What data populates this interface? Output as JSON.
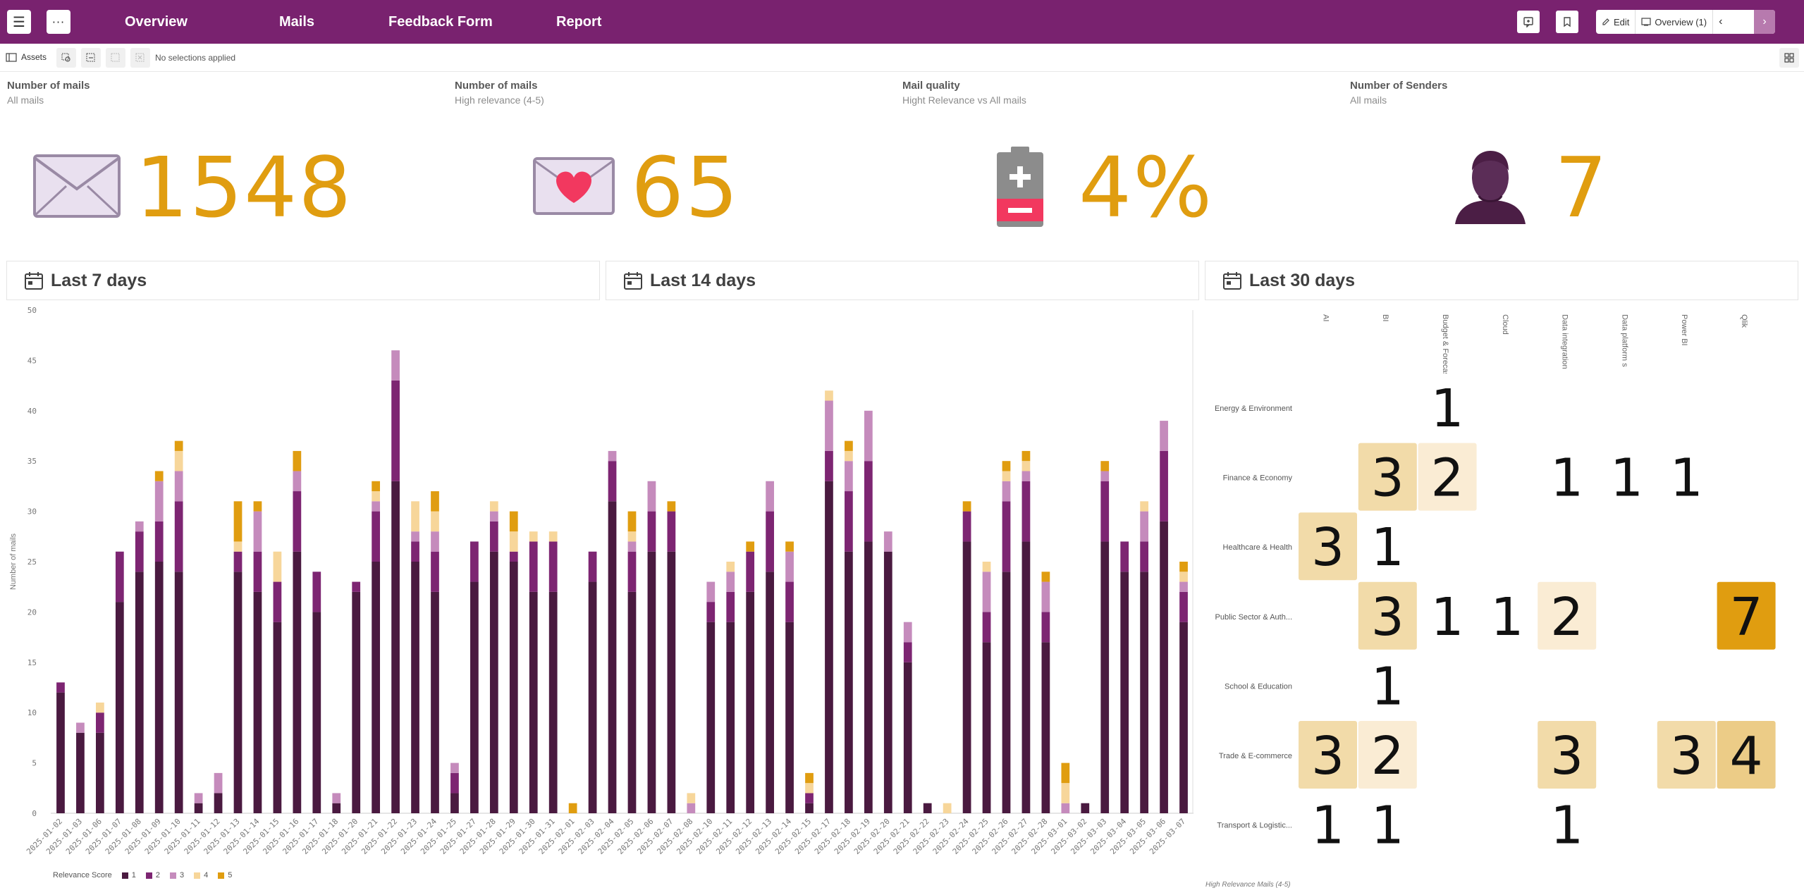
{
  "nav": {
    "tabs": [
      "Overview",
      "Mails",
      "Feedback Form",
      "Report"
    ],
    "edit_label": "Edit",
    "sheet_label": "Overview (1)"
  },
  "selection_bar": {
    "assets_label": "Assets",
    "status": "No selections applied"
  },
  "kpis": [
    {
      "title": "Number of mails",
      "subtitle": "All mails",
      "value": "1548",
      "icon": "envelope-icon"
    },
    {
      "title": "Number of mails",
      "subtitle": "High relevance (4-5)",
      "value": "65",
      "icon": "envelope-heart-icon"
    },
    {
      "title": "Mail quality",
      "subtitle": "Hight Relevance vs All mails",
      "value": "4%",
      "icon": "battery-icon"
    },
    {
      "title": "Number of Senders",
      "subtitle": "All mails",
      "value": "7",
      "icon": "person-icon"
    }
  ],
  "sections": [
    "Last 7 days",
    "Last 14 days",
    "Last 30 days"
  ],
  "colors": {
    "brand": "#79226f",
    "accent": "#e09d10",
    "score1": "#4a1a40",
    "score2": "#7d2572",
    "score3": "#c58bbc",
    "score4": "#f7d69a",
    "score5": "#e09d10"
  },
  "chart_data": [
    {
      "type": "bar",
      "stacked": true,
      "ylabel": "Number of mails",
      "ylim": [
        0,
        50
      ],
      "yticks": [
        0,
        5,
        10,
        15,
        20,
        25,
        30,
        35,
        40,
        45,
        50
      ],
      "legend_title": "Relevance Score",
      "legend_position": "bottom-left",
      "categories": [
        "2025-01-02",
        "2025-01-03",
        "2025-01-06",
        "2025-01-07",
        "2025-01-08",
        "2025-01-09",
        "2025-01-10",
        "2025-01-11",
        "2025-01-12",
        "2025-01-13",
        "2025-01-14",
        "2025-01-15",
        "2025-01-16",
        "2025-01-17",
        "2025-01-18",
        "2025-01-20",
        "2025-01-21",
        "2025-01-22",
        "2025-01-23",
        "2025-01-24",
        "2025-01-25",
        "2025-01-27",
        "2025-01-28",
        "2025-01-29",
        "2025-01-30",
        "2025-01-31",
        "2025-02-01",
        "2025-02-03",
        "2025-02-04",
        "2025-02-05",
        "2025-02-06",
        "2025-02-07",
        "2025-02-08",
        "2025-02-10",
        "2025-02-11",
        "2025-02-12",
        "2025-02-13",
        "2025-02-14",
        "2025-02-15",
        "2025-02-17",
        "2025-02-18",
        "2025-02-19",
        "2025-02-20",
        "2025-02-21",
        "2025-02-22",
        "2025-02-23",
        "2025-02-24",
        "2025-02-25",
        "2025-02-26",
        "2025-02-27",
        "2025-02-28",
        "2025-03-01",
        "2025-03-02",
        "2025-03-03",
        "2025-03-04",
        "2025-03-05",
        "2025-03-06",
        "2025-03-07"
      ],
      "series": [
        {
          "name": "1",
          "values": [
            12,
            8,
            8,
            21,
            24,
            25,
            24,
            1,
            2,
            24,
            22,
            19,
            26,
            20,
            1,
            22,
            25,
            33,
            25,
            22,
            2,
            23,
            26,
            25,
            22,
            22,
            0,
            23,
            31,
            22,
            26,
            26,
            0,
            19,
            19,
            22,
            24,
            19,
            1,
            33,
            26,
            27,
            26,
            15,
            1,
            0,
            27,
            17,
            24,
            27,
            17,
            0,
            1,
            27,
            24,
            24,
            29,
            19
          ]
        },
        {
          "name": "2",
          "values": [
            1,
            0,
            2,
            5,
            4,
            4,
            7,
            0,
            0,
            2,
            4,
            4,
            6,
            4,
            0,
            1,
            5,
            10,
            2,
            4,
            2,
            4,
            3,
            1,
            5,
            5,
            0,
            3,
            4,
            4,
            4,
            4,
            0,
            2,
            3,
            4,
            6,
            4,
            1,
            3,
            6,
            8,
            0,
            2,
            0,
            0,
            3,
            3,
            7,
            6,
            3,
            0,
            0,
            6,
            3,
            3,
            7,
            3
          ]
        },
        {
          "name": "3",
          "values": [
            0,
            1,
            0,
            0,
            1,
            4,
            3,
            1,
            2,
            0,
            4,
            0,
            2,
            0,
            1,
            0,
            1,
            3,
            1,
            2,
            1,
            0,
            1,
            0,
            0,
            0,
            0,
            0,
            1,
            1,
            3,
            0,
            1,
            2,
            2,
            0,
            3,
            3,
            0,
            5,
            3,
            5,
            2,
            2,
            0,
            0,
            0,
            4,
            2,
            1,
            3,
            1,
            0,
            1,
            0,
            3,
            3,
            1
          ]
        },
        {
          "name": "4",
          "values": [
            0,
            0,
            1,
            0,
            0,
            0,
            2,
            0,
            0,
            1,
            0,
            3,
            0,
            0,
            0,
            0,
            1,
            0,
            3,
            2,
            0,
            0,
            1,
            2,
            1,
            1,
            0,
            0,
            0,
            1,
            0,
            0,
            1,
            0,
            1,
            0,
            0,
            0,
            1,
            1,
            1,
            0,
            0,
            0,
            0,
            1,
            0,
            1,
            1,
            1,
            0,
            2,
            0,
            0,
            0,
            1,
            0,
            1
          ]
        },
        {
          "name": "5",
          "values": [
            0,
            0,
            0,
            0,
            0,
            1,
            1,
            0,
            0,
            4,
            1,
            0,
            2,
            0,
            0,
            0,
            1,
            0,
            0,
            2,
            0,
            0,
            0,
            2,
            0,
            0,
            1,
            0,
            0,
            2,
            0,
            1,
            0,
            0,
            0,
            1,
            0,
            1,
            1,
            0,
            1,
            0,
            0,
            0,
            0,
            0,
            1,
            0,
            1,
            1,
            1,
            2,
            0,
            1,
            0,
            0,
            0,
            1
          ]
        }
      ]
    },
    {
      "type": "heatmap",
      "caption": "High Relevance Mails (4-5)",
      "x": [
        "AI",
        "BI",
        "Budget & Forecas",
        "Cloud",
        "Data integration",
        "Data platform s",
        "Power BI",
        "Qlik"
      ],
      "y": [
        "Energy & Environment",
        "Finance & Economy",
        "Healthcare & Health",
        "Public Sector & Auth...",
        "School & Education",
        "Trade & E-commerce",
        "Transport & Logistic..."
      ],
      "values": [
        [
          null,
          null,
          1,
          null,
          null,
          null,
          null,
          null
        ],
        [
          null,
          3,
          2,
          null,
          1,
          1,
          1,
          null
        ],
        [
          3,
          1,
          null,
          null,
          null,
          null,
          null,
          null
        ],
        [
          null,
          3,
          1,
          1,
          2,
          null,
          null,
          7
        ],
        [
          null,
          1,
          null,
          null,
          null,
          null,
          null,
          null
        ],
        [
          3,
          2,
          null,
          null,
          3,
          null,
          3,
          4
        ],
        [
          1,
          1,
          null,
          null,
          1,
          null,
          null,
          null
        ]
      ]
    }
  ]
}
